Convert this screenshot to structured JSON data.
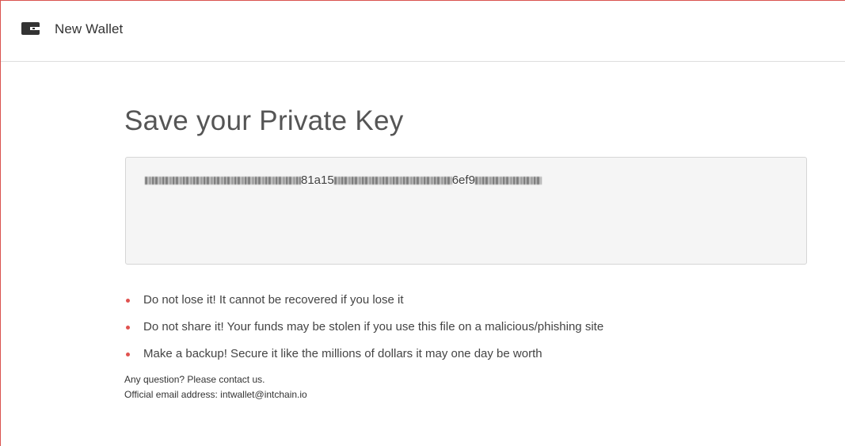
{
  "header": {
    "icon": "wallet-icon",
    "title": "New Wallet"
  },
  "main": {
    "title": "Save your Private Key",
    "private_key": {
      "visible_fragments": [
        "81a15",
        "6ef9"
      ]
    },
    "warnings": [
      "Do not lose it! It cannot be recovered if you lose it",
      "Do not share it! Your funds may be stolen if you use this file on a malicious/phishing site",
      "Make a backup! Secure it like the millions of dollars it may one day be worth"
    ],
    "contact": {
      "question": "Any question? Please contact us.",
      "email_line": "Official email address: intwallet@intchain.io"
    }
  },
  "colors": {
    "bullet": "#e0524f",
    "frame_border": "#d9534f",
    "key_box_bg": "#f5f5f5"
  }
}
